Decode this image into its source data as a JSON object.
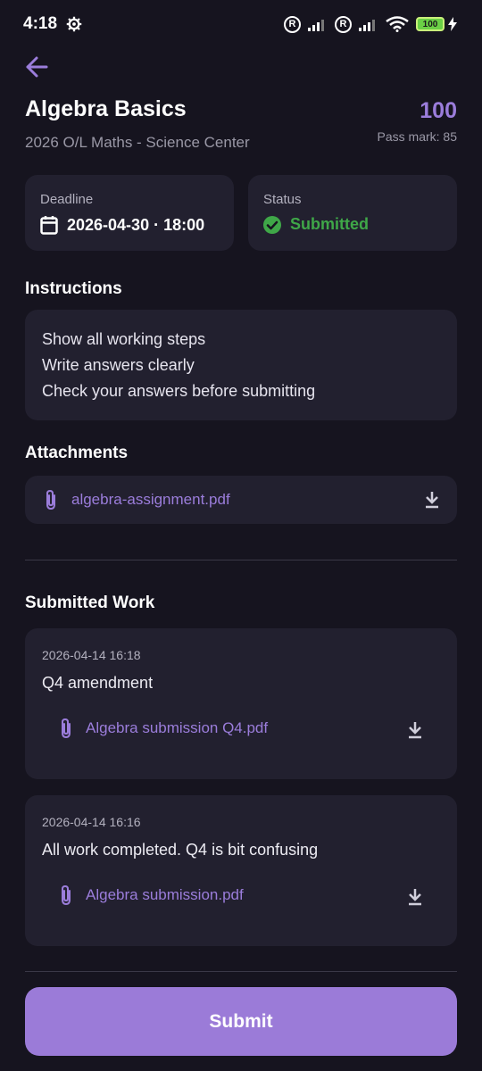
{
  "status_bar": {
    "time": "4:18",
    "battery": "100"
  },
  "header": {
    "title": "Algebra Basics",
    "subtitle": "2026 O/L Maths - Science Center",
    "score": "100",
    "pass_mark": "Pass mark: 85"
  },
  "deadline": {
    "label": "Deadline",
    "value": "2026-04-30 · 18:00"
  },
  "status": {
    "label": "Status",
    "value": "Submitted",
    "color": "#3fa748"
  },
  "instructions": {
    "title": "Instructions",
    "lines": [
      "Show all working steps",
      "Write answers clearly",
      "Check your answers before submitting"
    ]
  },
  "attachments": {
    "title": "Attachments",
    "items": [
      {
        "name": "algebra-assignment.pdf"
      }
    ]
  },
  "submitted_work": {
    "title": "Submitted Work",
    "items": [
      {
        "date": "2026-04-14 16:18",
        "text": "Q4 amendment",
        "file": "Algebra submission Q4.pdf"
      },
      {
        "date": "2026-04-14 16:16",
        "text": "All work completed. Q4 is bit confusing",
        "file": "Algebra submission.pdf"
      }
    ]
  },
  "submit_label": "Submit",
  "colors": {
    "background": "#16141f",
    "card": "#22202f",
    "accent": "#9b7ddb",
    "button": "#9b7bd8",
    "success": "#3fa748"
  }
}
